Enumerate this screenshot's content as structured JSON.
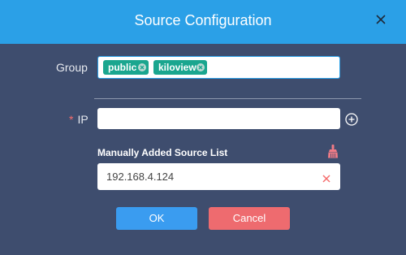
{
  "dialog": {
    "title": "Source Configuration",
    "group_label": "Group",
    "group_tags": [
      "public",
      "kiloview"
    ],
    "ip_label": "IP",
    "ip_required_mark": "*",
    "ip_value": "",
    "list_title": "Manually Added Source List",
    "list_items": [
      "192.168.4.124"
    ],
    "ok_label": "OK",
    "cancel_label": "Cancel"
  },
  "icons": {
    "close": "close-icon",
    "tag_close": "tag-close-icon",
    "add": "plus-circle-icon",
    "clear_list": "broom-icon",
    "remove_item": "x-icon"
  },
  "colors": {
    "header": "#2ba0e7",
    "background": "#3e4d6e",
    "tag": "#1aa68f",
    "ok": "#3a9cf0",
    "cancel": "#ee6b6f",
    "remove": "#f56c6c",
    "broom": "#ef7b86"
  }
}
